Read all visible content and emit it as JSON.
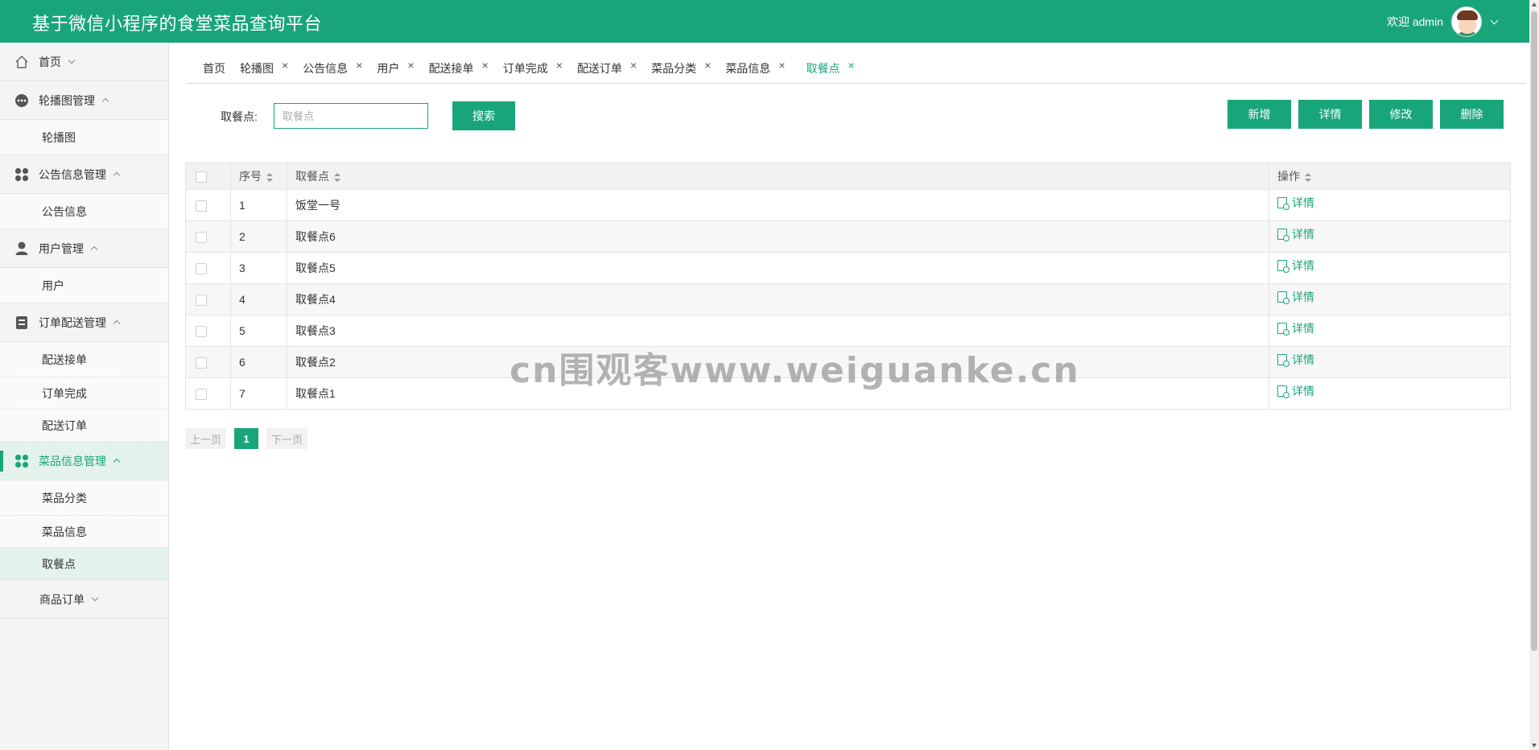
{
  "header": {
    "title": "基于微信小程序的食堂菜品查询平台",
    "welcome": "欢迎 admin",
    "brand_color": "#19a57a"
  },
  "sidebar": {
    "groups": [
      {
        "label": "首页",
        "icon": "home-icon"
      },
      {
        "label": "轮播图管理",
        "icon": "dots-icon",
        "items": [
          "轮播图"
        ]
      },
      {
        "label": "公告信息管理",
        "icon": "grid-icon",
        "items": [
          "公告信息"
        ]
      },
      {
        "label": "用户管理",
        "icon": "user-icon",
        "items": [
          "用户"
        ]
      },
      {
        "label": "订单配送管理",
        "icon": "box-icon",
        "items": [
          "配送接单",
          "订单完成",
          "配送订单"
        ]
      },
      {
        "label": "菜品信息管理",
        "icon": "grid-icon",
        "items": [
          "菜品分类",
          "菜品信息",
          "取餐点"
        ],
        "active": true
      },
      {
        "label": "商品订单"
      }
    ]
  },
  "tabs": [
    {
      "label": "首页",
      "closable": false
    },
    {
      "label": "轮播图",
      "closable": true
    },
    {
      "label": "公告信息",
      "closable": true
    },
    {
      "label": "用户",
      "closable": true
    },
    {
      "label": "配送接单",
      "closable": true
    },
    {
      "label": "订单完成",
      "closable": true
    },
    {
      "label": "配送订单",
      "closable": true
    },
    {
      "label": "菜品分类",
      "closable": true
    },
    {
      "label": "菜品信息",
      "closable": true
    },
    {
      "label": "取餐点",
      "closable": true,
      "active": true
    }
  ],
  "tab_close": "×",
  "search": {
    "label": "取餐点:",
    "placeholder": "取餐点",
    "button": "搜索"
  },
  "actions": {
    "add": "新增",
    "detail": "详情",
    "edit": "修改",
    "delete": "删除"
  },
  "table": {
    "columns": [
      "序号",
      "取餐点",
      "操作"
    ],
    "rows": [
      {
        "index": "1",
        "name": "饭堂一号",
        "op": "详情"
      },
      {
        "index": "2",
        "name": "取餐点6",
        "op": "详情"
      },
      {
        "index": "3",
        "name": "取餐点5",
        "op": "详情"
      },
      {
        "index": "4",
        "name": "取餐点4",
        "op": "详情"
      },
      {
        "index": "5",
        "name": "取餐点3",
        "op": "详情"
      },
      {
        "index": "6",
        "name": "取餐点2",
        "op": "详情"
      },
      {
        "index": "7",
        "name": "取餐点1",
        "op": "详情"
      }
    ]
  },
  "pagination": {
    "prev": "上一页",
    "current": "1",
    "next": "下一页"
  },
  "watermark": "cn围观客www.weiguanke.cn"
}
